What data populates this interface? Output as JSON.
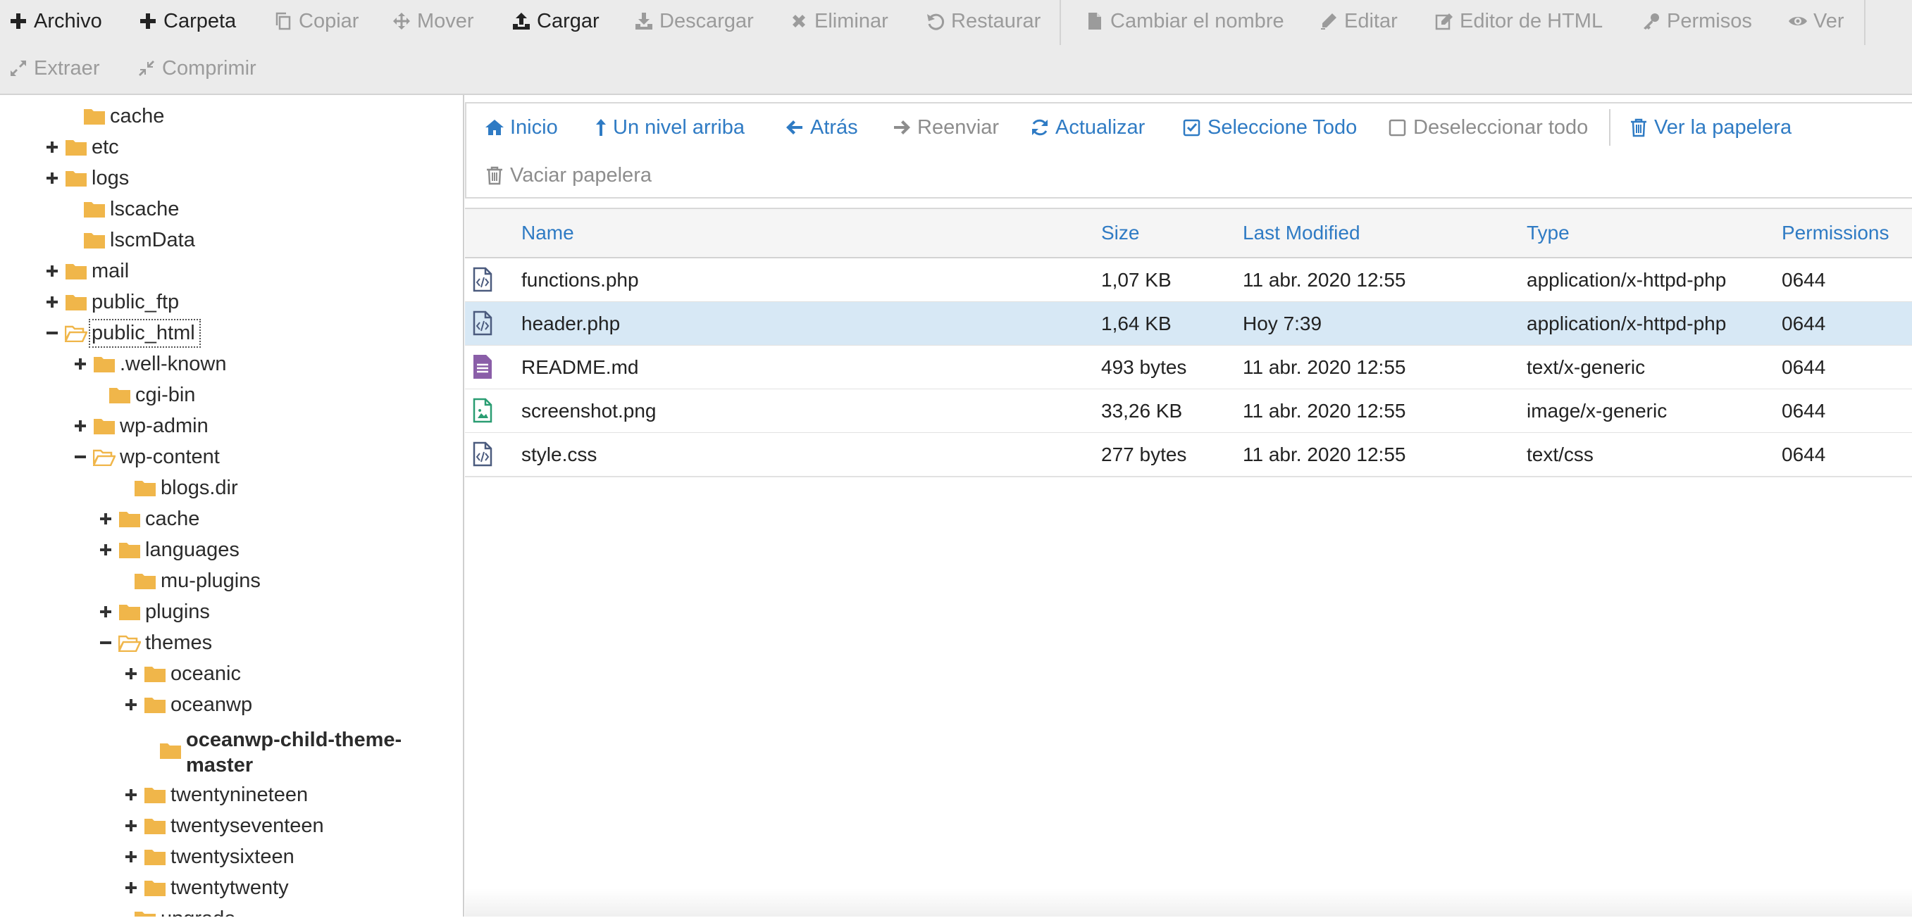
{
  "toolbar": {
    "row1": [
      {
        "icon": "plus-icon",
        "label": "Archivo",
        "enabled": true
      },
      {
        "icon": "plus-icon",
        "label": "Carpeta",
        "enabled": true
      },
      {
        "icon": "copy-icon",
        "label": "Copiar",
        "enabled": false
      },
      {
        "icon": "move-icon",
        "label": "Mover",
        "enabled": false
      },
      {
        "icon": "upload-icon",
        "label": "Cargar",
        "enabled": true
      },
      {
        "icon": "download-icon",
        "label": "Descargar",
        "enabled": false
      },
      {
        "icon": "close-icon",
        "label": "Eliminar",
        "enabled": false
      },
      {
        "icon": "undo-icon",
        "label": "Restaurar",
        "enabled": false
      },
      {
        "icon": "file-icon",
        "label": "Cambiar el nombre",
        "enabled": false
      },
      {
        "icon": "pencil-icon",
        "label": "Editar",
        "enabled": false
      },
      {
        "icon": "edit-icon",
        "label": "Editor de HTML",
        "enabled": false
      },
      {
        "icon": "key-icon",
        "label": "Permisos",
        "enabled": false
      },
      {
        "icon": "eye-icon",
        "label": "Ver",
        "enabled": false
      }
    ],
    "row2": [
      {
        "icon": "expand-icon",
        "label": "Extraer",
        "enabled": false
      },
      {
        "icon": "compress-icon",
        "label": "Comprimir",
        "enabled": false
      }
    ]
  },
  "tree": [
    {
      "label": "cache",
      "toggle": "none",
      "open": false
    },
    {
      "label": "etc",
      "toggle": "plus",
      "open": false
    },
    {
      "label": "logs",
      "toggle": "plus",
      "open": false
    },
    {
      "label": "lscache",
      "toggle": "none",
      "open": false
    },
    {
      "label": "lscmData",
      "toggle": "none",
      "open": false
    },
    {
      "label": "mail",
      "toggle": "plus",
      "open": false
    },
    {
      "label": "public_ftp",
      "toggle": "plus",
      "open": false
    },
    {
      "label": "public_html",
      "toggle": "minus",
      "open": true
    },
    {
      "label": ".well-known",
      "toggle": "plus",
      "open": false
    },
    {
      "label": "cgi-bin",
      "toggle": "none",
      "open": false
    },
    {
      "label": "wp-admin",
      "toggle": "plus",
      "open": false
    },
    {
      "label": "wp-content",
      "toggle": "minus",
      "open": true
    },
    {
      "label": "blogs.dir",
      "toggle": "none",
      "open": false
    },
    {
      "label": "cache",
      "toggle": "plus",
      "open": false
    },
    {
      "label": "languages",
      "toggle": "plus",
      "open": false
    },
    {
      "label": "mu-plugins",
      "toggle": "none",
      "open": false
    },
    {
      "label": "plugins",
      "toggle": "plus",
      "open": false
    },
    {
      "label": "themes",
      "toggle": "minus",
      "open": true
    },
    {
      "label": "oceanic",
      "toggle": "plus",
      "open": false
    },
    {
      "label": "oceanwp",
      "toggle": "plus",
      "open": false
    },
    {
      "label": "oceanwp-child-theme-master",
      "toggle": "none",
      "open": false,
      "current": true
    },
    {
      "label": "twentynineteen",
      "toggle": "plus",
      "open": false
    },
    {
      "label": "twentyseventeen",
      "toggle": "plus",
      "open": false
    },
    {
      "label": "twentysixteen",
      "toggle": "plus",
      "open": false
    },
    {
      "label": "twentytwenty",
      "toggle": "plus",
      "open": false
    },
    {
      "label": "upgrade",
      "toggle": "none",
      "open": false
    }
  ],
  "navbar": {
    "row1": [
      {
        "icon": "home-icon",
        "label": "Inicio",
        "enabled": true
      },
      {
        "icon": "level-up-icon",
        "label": "Un nivel arriba",
        "enabled": true
      },
      {
        "icon": "arrow-left-icon",
        "label": "Atrás",
        "enabled": true
      },
      {
        "icon": "arrow-right-icon",
        "label": "Reenviar",
        "enabled": false
      },
      {
        "icon": "refresh-icon",
        "label": "Actualizar",
        "enabled": true
      },
      {
        "icon": "checkbox-checked-icon",
        "label": "Seleccione Todo",
        "enabled": true
      },
      {
        "icon": "checkbox-empty-icon",
        "label": "Deseleccionar todo",
        "enabled": false
      },
      {
        "icon": "trash-icon",
        "label": "Ver la papelera",
        "enabled": true
      }
    ],
    "row2": [
      {
        "icon": "trash-icon",
        "label": "Vaciar papelera",
        "enabled": false
      }
    ]
  },
  "table": {
    "columns": [
      "Name",
      "Size",
      "Last Modified",
      "Type",
      "Permissions"
    ],
    "rows": [
      {
        "icon": "code-file-icon",
        "name": "functions.php",
        "size": "1,07 KB",
        "modified": "11 abr. 2020 12:55",
        "type": "application/x-httpd-php",
        "perms": "0644",
        "selected": false
      },
      {
        "icon": "code-file-icon",
        "name": "header.php",
        "size": "1,64 KB",
        "modified": "Hoy 7:39",
        "type": "application/x-httpd-php",
        "perms": "0644",
        "selected": true
      },
      {
        "icon": "text-file-icon",
        "name": "README.md",
        "size": "493 bytes",
        "modified": "11 abr. 2020 12:55",
        "type": "text/x-generic",
        "perms": "0644",
        "selected": false
      },
      {
        "icon": "image-file-icon",
        "name": "screenshot.png",
        "size": "33,26 KB",
        "modified": "11 abr. 2020 12:55",
        "type": "image/x-generic",
        "perms": "0644",
        "selected": false
      },
      {
        "icon": "code-file-icon",
        "name": "style.css",
        "size": "277 bytes",
        "modified": "11 abr. 2020 12:55",
        "type": "text/css",
        "perms": "0644",
        "selected": false
      }
    ]
  },
  "colors": {
    "link": "#2f7bc4",
    "folder": "#f0b64a",
    "selected_row": "#d7e8f5",
    "disabled": "#9b9b9b",
    "code_icon": "#4b5b7e",
    "text_icon": "#8a5ea8",
    "image_icon": "#2a9d72"
  }
}
